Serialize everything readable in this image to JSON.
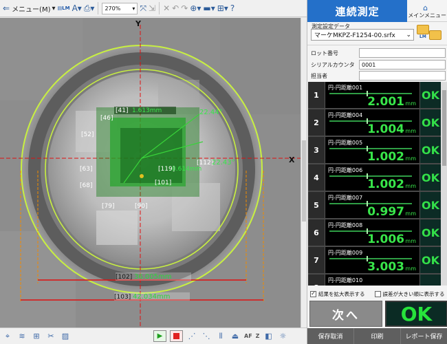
{
  "toolbar": {
    "menu_label": "メニュー(M)",
    "zoom_value": "270%"
  },
  "viewer": {
    "axis_x": "X",
    "axis_y": "Y",
    "labels": [
      {
        "id": "[41]",
        "value": "1.613mm"
      },
      {
        "id": "[46]",
        "value": ""
      },
      {
        "id": "[52]",
        "value": ""
      },
      {
        "id": "[62]",
        "value": "22.44°"
      },
      {
        "id": "[112]",
        "value": "22.43°"
      },
      {
        "id": "[63]",
        "value": ""
      },
      {
        "id": "[119]",
        "value": "0.614mm"
      },
      {
        "id": "[101]",
        "value": ""
      },
      {
        "id": "[68]",
        "value": ""
      },
      {
        "id": "[79]",
        "value": ""
      },
      {
        "id": "[90]",
        "value": ""
      },
      {
        "id": "[102]",
        "value": "36.005mm"
      },
      {
        "id": "[103]",
        "value": "42.034mm"
      }
    ]
  },
  "panel": {
    "title": "連続測定",
    "main_menu": "メインメニュー",
    "settings_label": "測定設定データ",
    "settings_file": "マーケMKPZ-F1254-00.srfx",
    "fields": [
      {
        "label": "ロット番号",
        "value": ""
      },
      {
        "label": "シリアルカウンタ",
        "value": "0001"
      },
      {
        "label": "担当者",
        "value": ""
      }
    ],
    "results": [
      {
        "num": "1",
        "name": "円-円距離001",
        "value": "2.001",
        "unit": "mm",
        "status": "OK"
      },
      {
        "num": "2",
        "name": "円-円距離004",
        "value": "1.004",
        "unit": "mm",
        "status": "OK"
      },
      {
        "num": "3",
        "name": "円-円距離005",
        "value": "1.002",
        "unit": "mm",
        "status": "OK"
      },
      {
        "num": "4",
        "name": "円-円距離006",
        "value": "1.002",
        "unit": "mm",
        "status": "OK"
      },
      {
        "num": "5",
        "name": "円-円距離007",
        "value": "0.997",
        "unit": "mm",
        "status": "OK"
      },
      {
        "num": "6",
        "name": "円-円距離008",
        "value": "1.006",
        "unit": "mm",
        "status": "OK"
      },
      {
        "num": "7",
        "name": "円-円距離009",
        "value": "3.003",
        "unit": "mm",
        "status": "OK"
      },
      {
        "num": "8",
        "name": "円-円距離010",
        "value": "",
        "unit": "",
        "status": ""
      }
    ],
    "check_enlarge": "結果を拡大表示する",
    "check_error_order": "誤差が大きい順に表示する",
    "next_button": "次へ",
    "overall_status": "OK",
    "bottom_buttons": [
      "保存取消",
      "印刷",
      "レポート保存"
    ]
  },
  "colors": {
    "accent_blue": "#2470c9",
    "ok_green": "#38e64a",
    "dark_bg": "#0b2b24"
  }
}
